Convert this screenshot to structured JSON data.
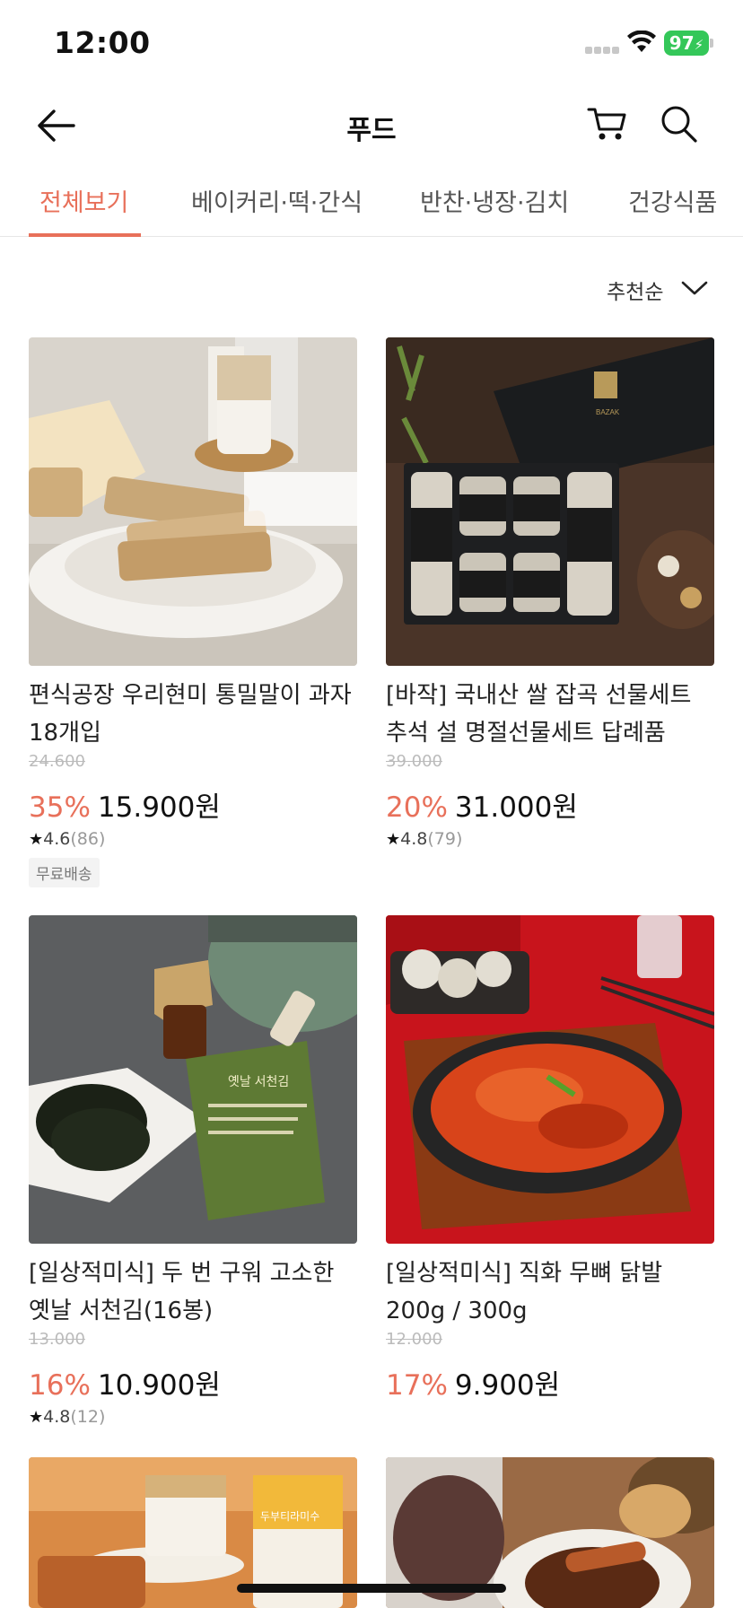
{
  "status_bar": {
    "time": "12:00",
    "battery": "97"
  },
  "header": {
    "title": "푸드"
  },
  "tabs": [
    {
      "label": "전체보기",
      "active": true
    },
    {
      "label": "베이커리·떡·간식",
      "active": false
    },
    {
      "label": "반찬·냉장·김치",
      "active": false
    },
    {
      "label": "건강식품",
      "active": false
    }
  ],
  "sort": {
    "label": "추천순"
  },
  "products": [
    {
      "name": "편식공장 우리현미 통밀말이 과자 18개입",
      "original_price": "24.600",
      "discount": "35%",
      "price": "15.900원",
      "rating": "4.6",
      "review_count": "(86)",
      "badge": "무료배송"
    },
    {
      "name": "[바작] 국내산 쌀 잡곡 선물세트 추석 설 명절선물세트 답례품",
      "original_price": "39.000",
      "discount": "20%",
      "price": "31.000원",
      "rating": "4.8",
      "review_count": "(79)"
    },
    {
      "name": "[일상적미식] 두 번 구워 고소한 옛날 서천김(16봉)",
      "original_price": "13.000",
      "discount": "16%",
      "price": "10.900원",
      "rating": "4.8",
      "review_count": "(12)"
    },
    {
      "name": "[일상적미식] 직화 무뼈 닭발 200g / 300g",
      "original_price": "12.000",
      "discount": "17%",
      "price": "9.900원"
    }
  ],
  "product_image_text": {
    "bazak_logo": "BAZAK",
    "seaweed_pack": "옛날 서천김",
    "tiramisu_pack": "두부티라미수"
  },
  "colors": {
    "accent": "#e8705a",
    "battery": "#34c759"
  }
}
